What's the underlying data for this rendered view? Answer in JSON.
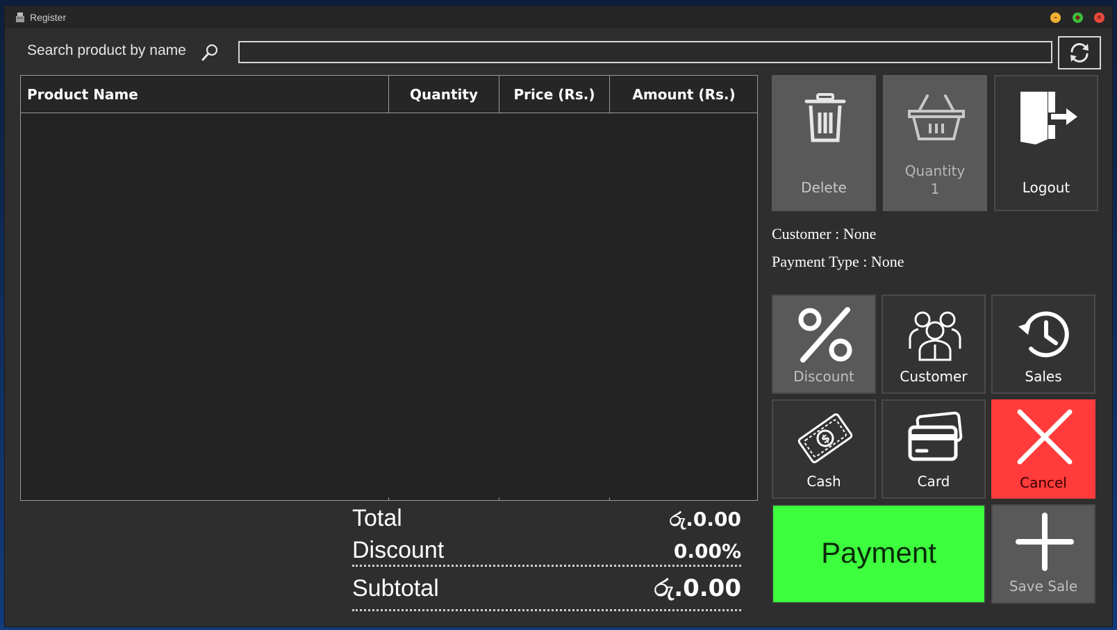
{
  "window": {
    "title": "Register"
  },
  "search": {
    "label": "Search product by name",
    "value": ""
  },
  "table": {
    "columns": [
      "Product Name",
      "Quantity",
      "Price (Rs.)",
      "Amount (Rs.)"
    ],
    "rows": []
  },
  "totals": {
    "total_label": "Total",
    "total_value": "රු.0.00",
    "discount_label": "Discount",
    "discount_value": "0.00%",
    "subtotal_label": "Subtotal",
    "subtotal_value": "රු.0.00"
  },
  "actions": {
    "delete": "Delete",
    "quantity_label": "Quantity",
    "quantity_value": "1",
    "logout": "Logout"
  },
  "info": {
    "customer_label": "Customer",
    "customer_value": "None",
    "payment_type_label": "Payment Type",
    "payment_type_value": "None"
  },
  "tiles": {
    "discount": "Discount",
    "customer": "Customer",
    "sales": "Sales",
    "cash": "Cash",
    "card": "Card",
    "cancel": "Cancel",
    "payment": "Payment",
    "save_sale": "Save Sale"
  },
  "colors": {
    "payment_bg": "#3dff3d",
    "cancel_bg": "#ff3b3b",
    "tile_gray": "#595959",
    "tile_dark": "#333333"
  },
  "icons": {
    "delete": "trash-icon",
    "quantity": "basket-icon",
    "logout": "exit-door-icon",
    "discount": "percent-icon",
    "customer": "users-icon",
    "sales": "history-clock-icon",
    "cash": "banknote-icon",
    "card": "credit-card-icon",
    "cancel": "x-icon",
    "save_sale": "plus-icon",
    "refresh": "refresh-icon",
    "search": "search-icon"
  }
}
